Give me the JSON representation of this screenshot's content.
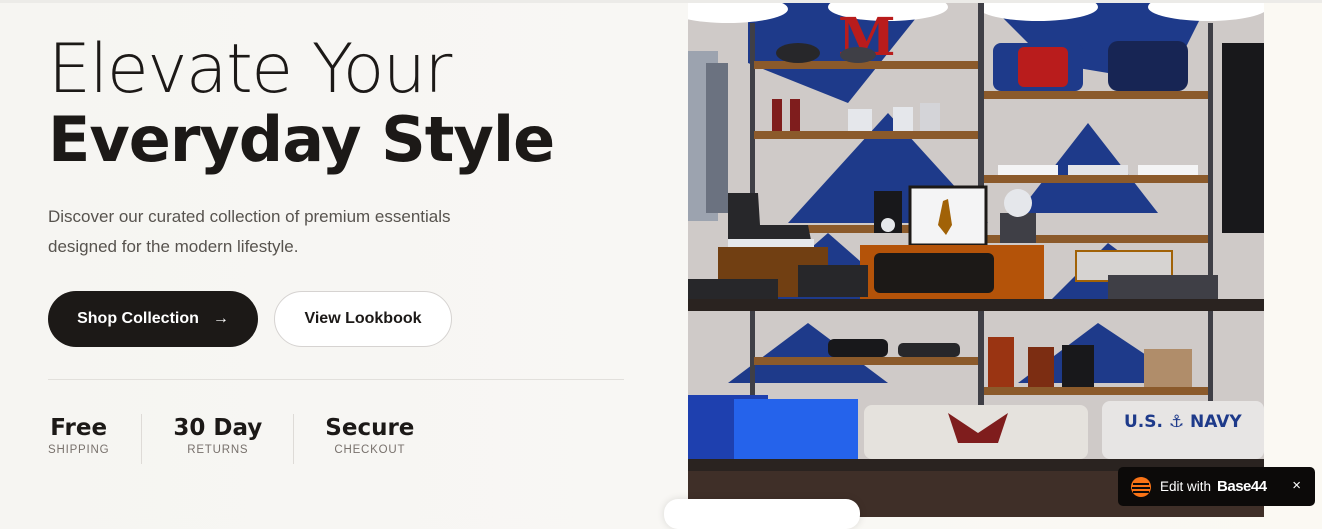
{
  "hero": {
    "title_line1": "Elevate Your",
    "title_line2": "Everyday Style",
    "subtitle": "Discover our curated collection of premium essentials designed for the modern lifestyle.",
    "primary_button": "Shop Collection",
    "primary_button_icon": "arrow-right-icon",
    "secondary_button": "View Lookbook"
  },
  "stats": [
    {
      "value": "Free",
      "label": "SHIPPING"
    },
    {
      "value": "30 Day",
      "label": "RETURNS"
    },
    {
      "value": "Secure",
      "label": "CHECKOUT"
    }
  ],
  "badge": {
    "edit_label": "Edit with",
    "brand": "Base44",
    "close": "×"
  },
  "photo_text": {
    "sign_letter": "M",
    "shirt_text": "U.S. ⚓ NAVY"
  },
  "colors": {
    "primary": "#1c1917",
    "background": "#f7f6f3",
    "accent_orange": "#f97316"
  }
}
